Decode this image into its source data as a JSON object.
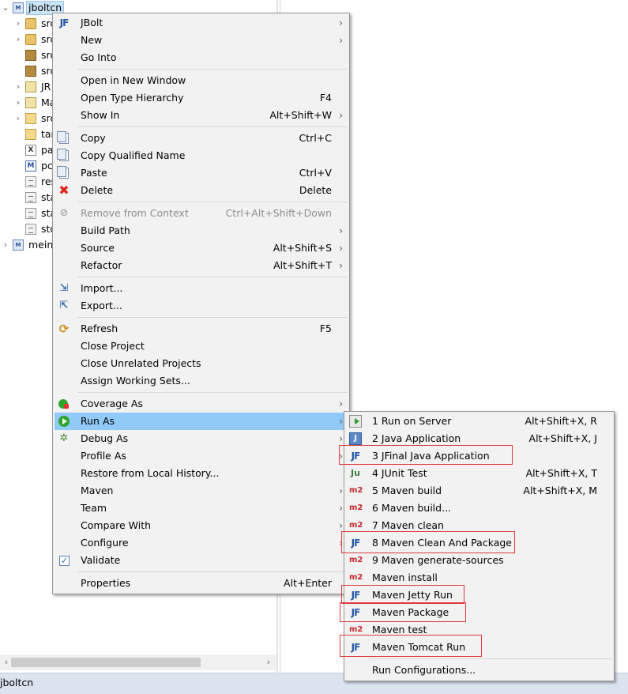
{
  "explorer": {
    "root_label": "jboltcn",
    "children": [
      "src",
      "src",
      "src",
      "src",
      "JR",
      "Ma",
      "src",
      "tar",
      "pa",
      "pc",
      "res",
      "sta",
      "sta",
      "sto"
    ],
    "second_project": "meinv",
    "scroll_left_arrow": "‹",
    "scroll_right_arrow": "›"
  },
  "status_bar": {
    "text": "jboltcn"
  },
  "context_menu": {
    "items": [
      {
        "label": "JBolt",
        "icon": "jf-icon",
        "submenu": true
      },
      {
        "label": "New",
        "submenu": true
      },
      {
        "label": "Go Into"
      },
      {
        "label": "Open in New Window"
      },
      {
        "label": "Open Type Hierarchy",
        "shortcut": "F4"
      },
      {
        "label": "Show In",
        "shortcut": "Alt+Shift+W",
        "submenu": true
      },
      {
        "label": "Copy",
        "shortcut": "Ctrl+C",
        "icon": "copy-icon"
      },
      {
        "label": "Copy Qualified Name",
        "icon": "copy-icon"
      },
      {
        "label": "Paste",
        "shortcut": "Ctrl+V",
        "icon": "paste-icon"
      },
      {
        "label": "Delete",
        "shortcut": "Delete",
        "icon": "delete-icon"
      },
      {
        "label": "Remove from Context",
        "shortcut": "Ctrl+Alt+Shift+Down",
        "icon": "remove-context-icon",
        "disabled": true
      },
      {
        "label": "Build Path",
        "submenu": true
      },
      {
        "label": "Source",
        "shortcut": "Alt+Shift+S",
        "submenu": true
      },
      {
        "label": "Refactor",
        "shortcut": "Alt+Shift+T",
        "submenu": true
      },
      {
        "label": "Import...",
        "icon": "import-icon"
      },
      {
        "label": "Export...",
        "icon": "export-icon"
      },
      {
        "label": "Refresh",
        "shortcut": "F5",
        "icon": "refresh-icon"
      },
      {
        "label": "Close Project"
      },
      {
        "label": "Close Unrelated Projects"
      },
      {
        "label": "Assign Working Sets..."
      },
      {
        "label": "Coverage As",
        "icon": "coverage-icon",
        "submenu": true
      },
      {
        "label": "Run As",
        "icon": "run-icon",
        "submenu": true,
        "highlighted": true
      },
      {
        "label": "Debug As",
        "icon": "debug-icon",
        "submenu": true
      },
      {
        "label": "Profile As",
        "submenu": true
      },
      {
        "label": "Restore from Local History..."
      },
      {
        "label": "Maven",
        "submenu": true
      },
      {
        "label": "Team",
        "submenu": true
      },
      {
        "label": "Compare With",
        "submenu": true
      },
      {
        "label": "Configure",
        "submenu": true
      },
      {
        "label": "Validate",
        "icon": "checkbox-icon"
      },
      {
        "label": "Properties",
        "shortcut": "Alt+Enter"
      }
    ]
  },
  "run_as_menu": {
    "items": [
      {
        "label": "1 Run on Server",
        "shortcut": "Alt+Shift+X, R",
        "icon": "server-icon"
      },
      {
        "label": "2 Java Application",
        "shortcut": "Alt+Shift+X, J",
        "icon": "java-app-icon",
        "icon_text": "J"
      },
      {
        "label": "3 JFinal Java Application",
        "icon": "jf-icon",
        "icon_text": "JF",
        "marked": true
      },
      {
        "label": "4 JUnit Test",
        "shortcut": "Alt+Shift+X, T",
        "icon": "junit-icon",
        "icon_text": "Ju"
      },
      {
        "label": "5 Maven build",
        "shortcut": "Alt+Shift+X, M",
        "icon": "m2-icon",
        "icon_text": "m2"
      },
      {
        "label": "6 Maven build...",
        "icon": "m2-icon",
        "icon_text": "m2"
      },
      {
        "label": "7 Maven clean",
        "icon": "m2-icon",
        "icon_text": "m2"
      },
      {
        "label": "8 Maven Clean And Package",
        "icon": "jf-icon",
        "icon_text": "JF",
        "marked": true
      },
      {
        "label": "9 Maven generate-sources",
        "icon": "m2-icon",
        "icon_text": "m2"
      },
      {
        "label": "Maven install",
        "icon": "m2-icon",
        "icon_text": "m2"
      },
      {
        "label": "Maven Jetty Run",
        "icon": "jf-icon",
        "icon_text": "JF",
        "marked": true
      },
      {
        "label": "Maven Package",
        "icon": "jf-icon",
        "icon_text": "JF",
        "marked": true
      },
      {
        "label": "Maven test",
        "icon": "m2-icon",
        "icon_text": "m2"
      },
      {
        "label": "Maven Tomcat Run",
        "icon": "jf-icon",
        "icon_text": "JF",
        "marked": true
      },
      {
        "label": "Run Configurations..."
      }
    ]
  },
  "colors": {
    "highlight": "#91c9f7",
    "menu_bg": "#f2f2f2",
    "annotation_red": "#e0393e",
    "status_bar": "#dbe3ef"
  }
}
